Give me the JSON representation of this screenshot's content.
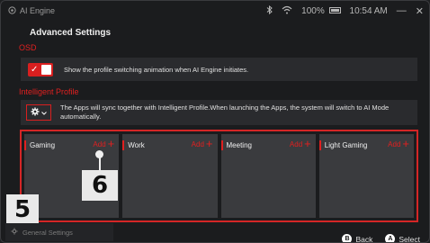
{
  "titlebar": {
    "app_name": "AI Engine",
    "battery": "100%",
    "time": "10:54 AM",
    "minimize": "—",
    "close": "✕"
  },
  "header": {
    "title": "Advanced Settings"
  },
  "osd": {
    "section_label": "OSD",
    "toggle_on": true,
    "description": "Show the profile switching animation when AI Engine initiates."
  },
  "intelligent_profile": {
    "section_label": "Intelligent Profile",
    "description": "The Apps will sync together with Intelligent Profile.When launching the Apps, the system will switch to AI Mode automatically."
  },
  "profiles": [
    {
      "name": "Gaming",
      "add_label": "Add"
    },
    {
      "name": "Work",
      "add_label": "Add"
    },
    {
      "name": "Meeting",
      "add_label": "Add"
    },
    {
      "name": "Light Gaming",
      "add_label": "Add"
    }
  ],
  "callouts": {
    "six": "6",
    "five": "5"
  },
  "sidebar": {
    "general_settings": "General Settings"
  },
  "hints": {
    "back_key": "B",
    "back_label": "Back",
    "select_key": "A",
    "select_label": "Select"
  },
  "colors": {
    "accent": "#e02020",
    "background": "#1b1c1e",
    "card": "#3a3b3e"
  }
}
